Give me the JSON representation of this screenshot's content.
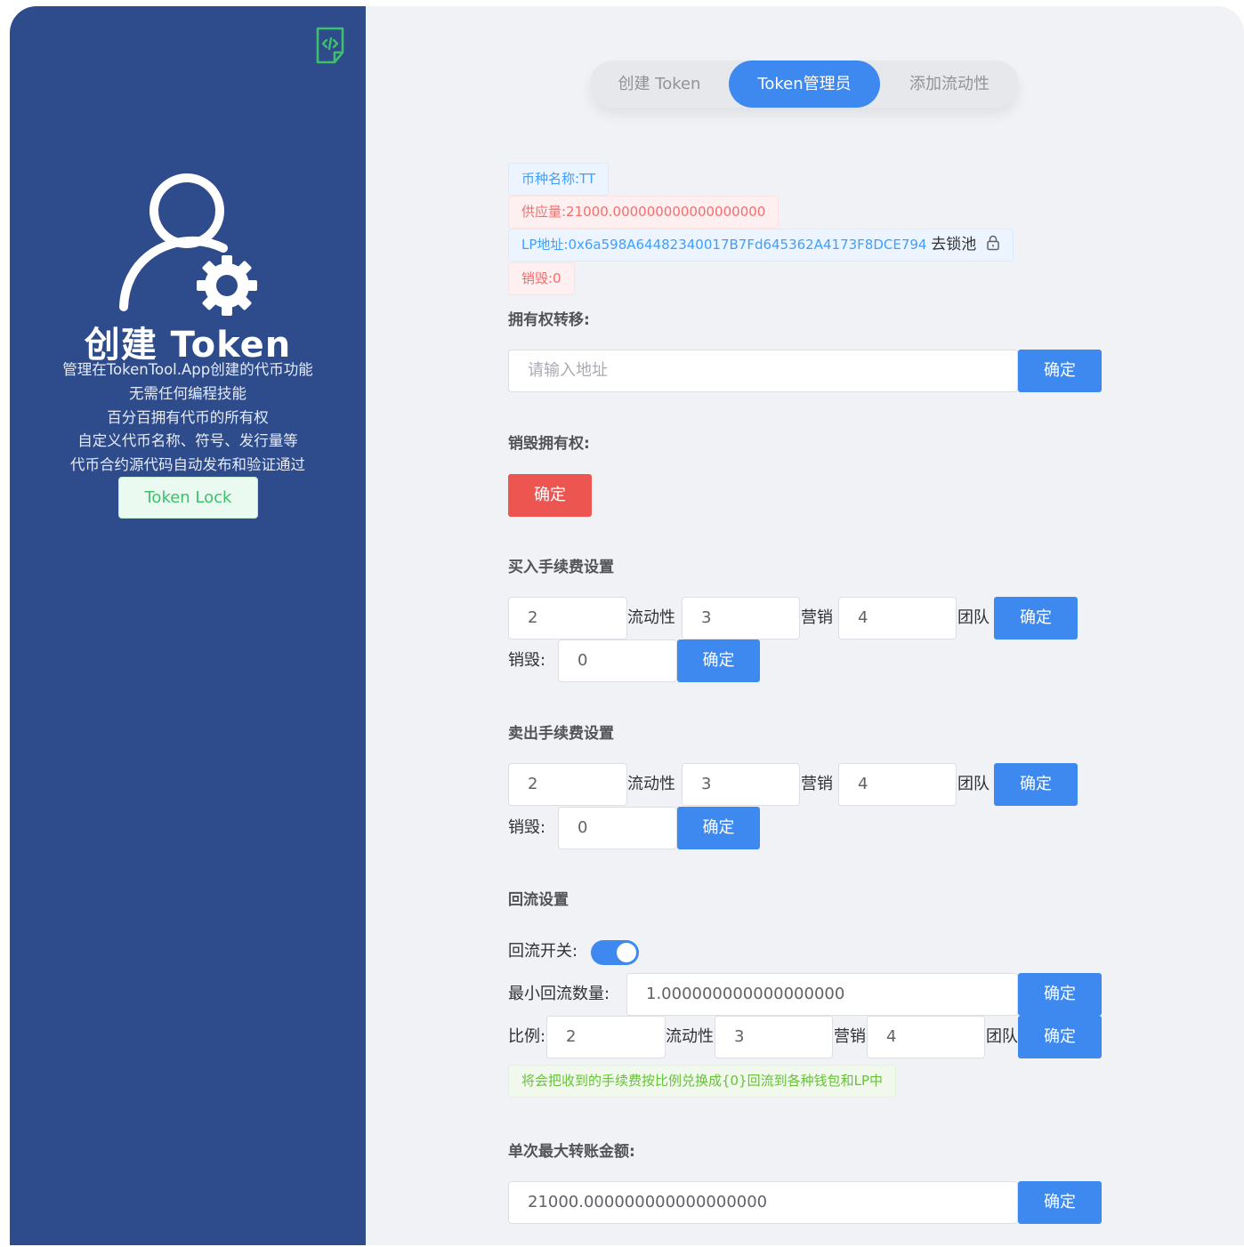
{
  "sidebar": {
    "title": "创建 Token",
    "lines": [
      "管理在TokenTool.App创建的代币功能",
      "无需任何编程技能",
      "百分百拥有代币的所有权",
      "自定义代币名称、符号、发行量等",
      "代币合约源代码自动发布和验证通过"
    ],
    "lock_button": "Token Lock"
  },
  "tabs": [
    "创建 Token",
    "Token管理员",
    "添加流动性"
  ],
  "active_tab": "Token管理员",
  "info": {
    "name": "币种名称:TT",
    "supply": "供应量:21000.000000000000000000",
    "lp": "LP地址:0x6a598A64482340017B7Fd645362A4173F8DCE794",
    "lp_lock": "去锁池",
    "burned": "销毁:0"
  },
  "ownership_transfer": {
    "label": "拥有权转移:",
    "placeholder": "请输入地址",
    "confirm": "确定"
  },
  "renounce": {
    "label": "销毁拥有权:",
    "confirm": "确定"
  },
  "buy_fees": {
    "label": "买入手续费设置",
    "liquidity": "2",
    "liquidity_label": "流动性",
    "marketing": "3",
    "marketing_label": "营销",
    "team": "4",
    "team_label": "团队",
    "confirm": "确定",
    "burn_label": "销毁:",
    "burn": "0",
    "burn_confirm": "确定"
  },
  "sell_fees": {
    "label": "卖出手续费设置",
    "liquidity": "2",
    "liquidity_label": "流动性",
    "marketing": "3",
    "marketing_label": "营销",
    "team": "4",
    "team_label": "团队",
    "confirm": "确定",
    "burn_label": "销毁:",
    "burn": "0",
    "burn_confirm": "确定"
  },
  "reflow": {
    "label": "回流设置",
    "switch_label": "回流开关:",
    "switch_on": true,
    "min_label": "最小回流数量:",
    "min_value": "1.000000000000000000",
    "min_confirm": "确定",
    "ratio_label": "比例:",
    "ratio_liquidity": "2",
    "liquidity_label": "流动性",
    "ratio_marketing": "3",
    "marketing_label": "营销",
    "ratio_team": "4",
    "team_label": "团队",
    "ratio_confirm": "确定",
    "note": "将会把收到的手续费按比例兑换成{0}回流到各种钱包和LP中"
  },
  "max_transfer": {
    "label": "单次最大转账金额:",
    "value": "21000.000000000000000000",
    "confirm": "确定"
  },
  "colors": {
    "sidebar": "#2e4c8b",
    "primary": "#3d89f0",
    "danger": "#ec5550",
    "background": "#f0f2f5"
  }
}
